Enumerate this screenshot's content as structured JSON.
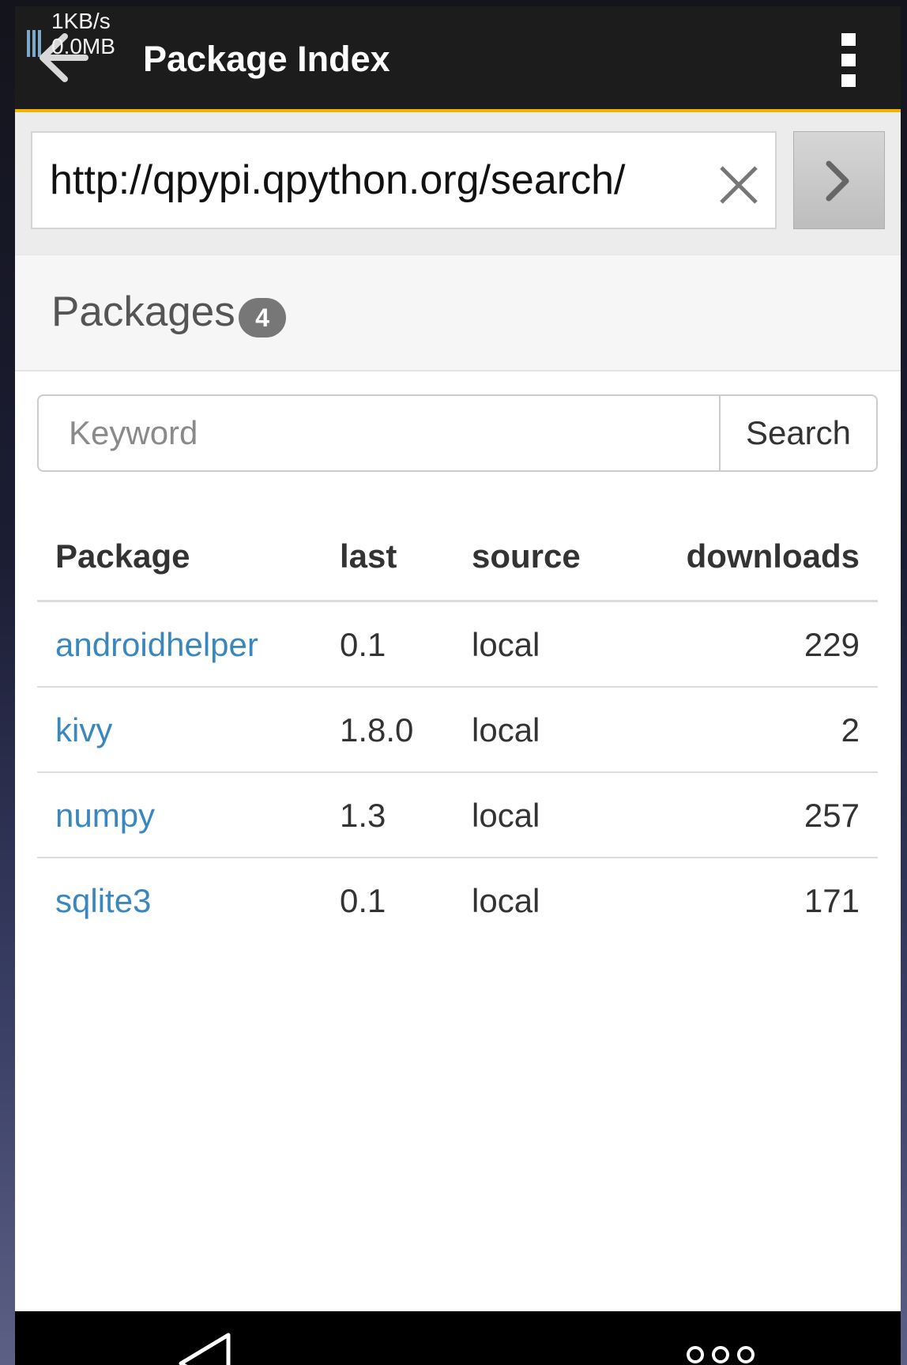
{
  "status_bar": {
    "net_speed": "1KB/s",
    "data_used": "0.0MB"
  },
  "app_bar": {
    "title": "Package Index"
  },
  "url_bar": {
    "value": "http://qpypi.qpython.org/search/"
  },
  "packages_header": {
    "title": "Packages",
    "count": "4"
  },
  "search": {
    "placeholder": "Keyword",
    "button_label": "Search"
  },
  "table": {
    "headers": {
      "package": "Package",
      "last": "last",
      "source": "source",
      "downloads": "downloads"
    },
    "rows": [
      {
        "package": "androidhelper",
        "last": "0.1",
        "source": "local",
        "downloads": "229"
      },
      {
        "package": "kivy",
        "last": "1.8.0",
        "source": "local",
        "downloads": "2"
      },
      {
        "package": "numpy",
        "last": "1.3",
        "source": "local",
        "downloads": "257"
      },
      {
        "package": "sqlite3",
        "last": "0.1",
        "source": "local",
        "downloads": "171"
      }
    ]
  },
  "colors": {
    "appbar": "#1c1c1c",
    "accent_line": "#f0b400",
    "link": "#3a87c0",
    "badge": "#777777"
  },
  "icons": [
    "signal-icon",
    "back-arrow-icon",
    "overflow-menu-icon",
    "clear-icon",
    "chevron-right-icon",
    "nav-back-icon",
    "nav-recent-icon"
  ]
}
